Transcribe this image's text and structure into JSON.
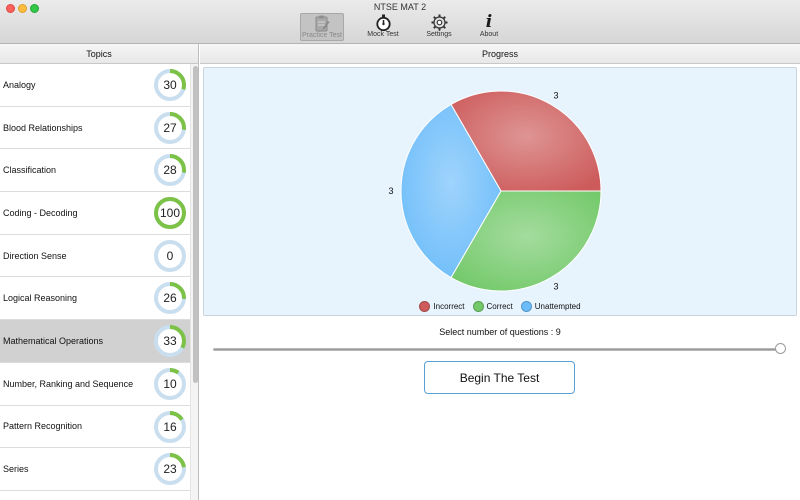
{
  "window": {
    "title": "NTSE MAT 2"
  },
  "toolbar": {
    "items": [
      {
        "label": "Practice Test",
        "icon": "clipboard-icon",
        "active": true
      },
      {
        "label": "Mock Test",
        "icon": "stopwatch-icon",
        "active": false
      },
      {
        "label": "Settings",
        "icon": "gear-icon",
        "active": false
      },
      {
        "label": "About",
        "icon": "info-icon",
        "active": false
      }
    ]
  },
  "sidebar": {
    "header": "Topics",
    "topics": [
      {
        "name": "Analogy",
        "score": "30",
        "percent": 30
      },
      {
        "name": "Blood Relationships",
        "score": "27",
        "percent": 27
      },
      {
        "name": "Classification",
        "score": "28",
        "percent": 28
      },
      {
        "name": "Coding - Decoding",
        "score": "100",
        "percent": 100
      },
      {
        "name": "Direction Sense",
        "score": "0",
        "percent": 0
      },
      {
        "name": "Logical Reasoning",
        "score": "26",
        "percent": 26
      },
      {
        "name": "Mathematical Operations",
        "score": "33",
        "percent": 33,
        "selected": true
      },
      {
        "name": "Number, Ranking and Sequence",
        "score": "10",
        "percent": 10
      },
      {
        "name": "Pattern Recognition",
        "score": "16",
        "percent": 16
      },
      {
        "name": "Series",
        "score": "23",
        "percent": 23
      }
    ]
  },
  "main": {
    "header": "Progress",
    "question_count_label": "Select number of questions : 9",
    "slider_value": 1.0,
    "begin_button": "Begin The Test"
  },
  "colors": {
    "ring_fill": "#7cc247",
    "ring_track": "#c9dff0",
    "incorrect": "#cd5b5b",
    "correct": "#73c96a",
    "unattempted": "#6bbcfa"
  },
  "chart_data": {
    "type": "pie",
    "categories": [
      "Incorrect",
      "Correct",
      "Unattempted"
    ],
    "values": [
      3,
      3,
      3
    ],
    "data_labels": [
      "3",
      "3",
      "3"
    ],
    "legend_position": "bottom"
  }
}
